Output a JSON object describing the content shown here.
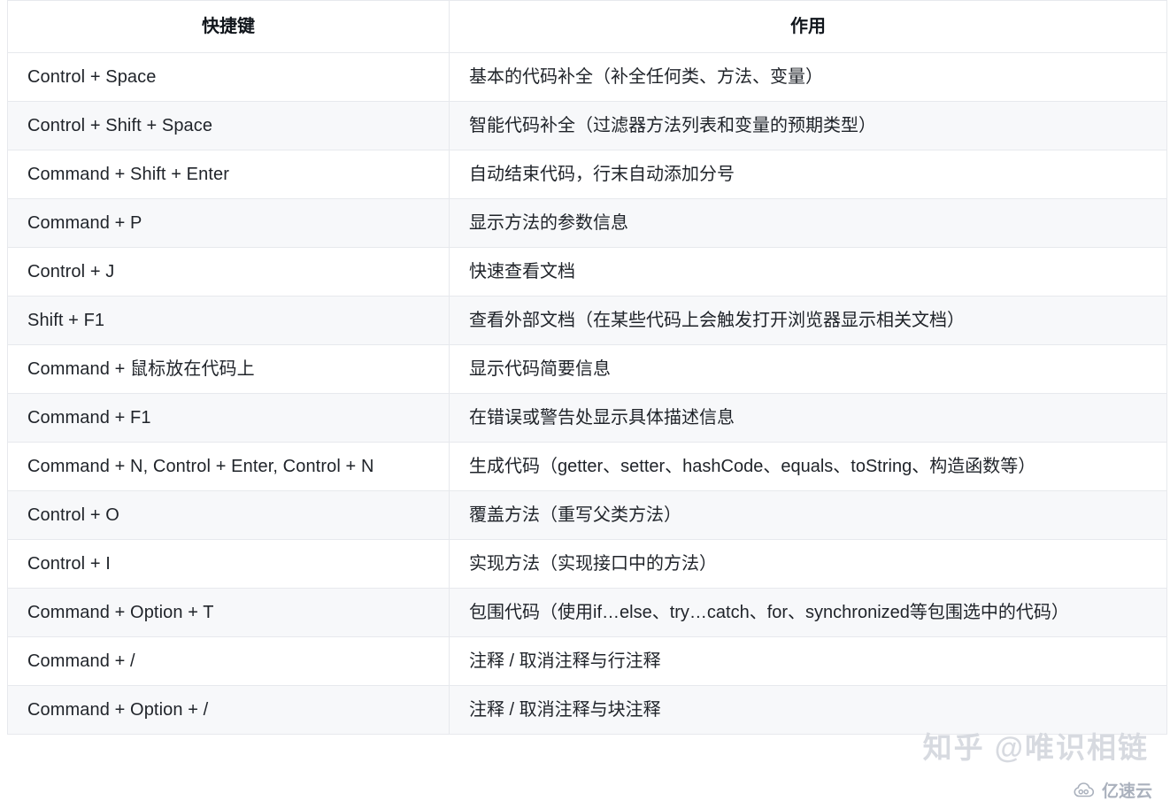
{
  "table": {
    "headers": {
      "shortcut": "快捷键",
      "action": "作用"
    },
    "rows": [
      {
        "shortcut": "Control + Space",
        "action": "基本的代码补全（补全任何类、方法、变量）"
      },
      {
        "shortcut": "Control + Shift + Space",
        "action": "智能代码补全（过滤器方法列表和变量的预期类型）"
      },
      {
        "shortcut": "Command + Shift + Enter",
        "action": "自动结束代码，行末自动添加分号"
      },
      {
        "shortcut": "Command + P",
        "action": "显示方法的参数信息"
      },
      {
        "shortcut": "Control + J",
        "action": "快速查看文档"
      },
      {
        "shortcut": "Shift + F1",
        "action": "查看外部文档（在某些代码上会触发打开浏览器显示相关文档）"
      },
      {
        "shortcut": "Command + 鼠标放在代码上",
        "action": "显示代码简要信息"
      },
      {
        "shortcut": "Command + F1",
        "action": "在错误或警告处显示具体描述信息"
      },
      {
        "shortcut": "Command + N, Control + Enter, Control + N",
        "action": "生成代码（getter、setter、hashCode、equals、toString、构造函数等）"
      },
      {
        "shortcut": "Control + O",
        "action": "覆盖方法（重写父类方法）"
      },
      {
        "shortcut": "Control + I",
        "action": "实现方法（实现接口中的方法）"
      },
      {
        "shortcut": "Command + Option + T",
        "action": "包围代码（使用if…else、try…catch、for、synchronized等包围选中的代码）"
      },
      {
        "shortcut": "Command + /",
        "action": "注释 / 取消注释与行注释"
      },
      {
        "shortcut": "Command + Option + /",
        "action": "注释 / 取消注释与块注释"
      }
    ]
  },
  "watermarks": {
    "zhihu": "知乎 @唯识相链",
    "yisuyun": "亿速云"
  },
  "colors": {
    "border": "#e7e9ed",
    "stripe": "#f7f8fa",
    "text": "#1f2329",
    "watermark": "#d7dae0"
  }
}
